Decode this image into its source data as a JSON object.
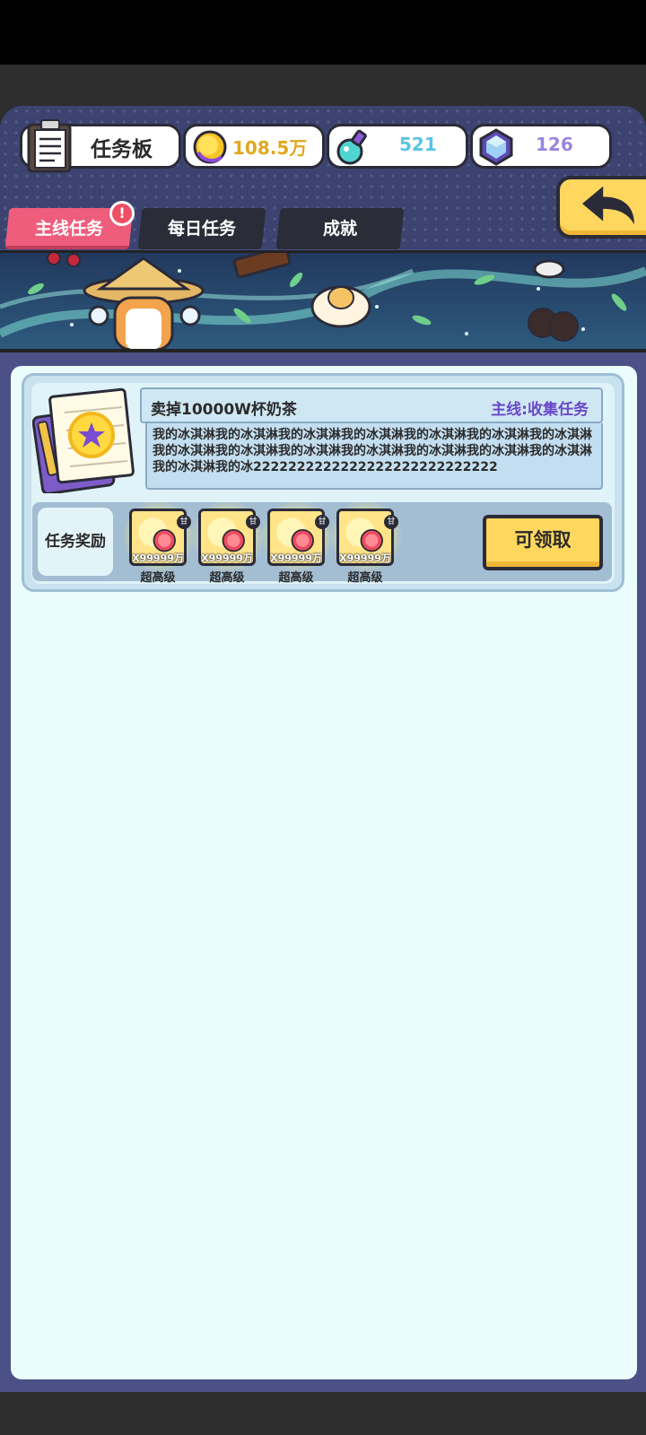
{
  "header": {
    "title": "任务板",
    "resources": {
      "gold": {
        "value": "108.5万",
        "color": "#e0a820"
      },
      "potion": {
        "value": "521",
        "color": "#5ac3e6"
      },
      "gem": {
        "value": "126",
        "color": "#9a84e0"
      }
    }
  },
  "tabs": [
    {
      "label": "主线任务",
      "active": true
    },
    {
      "label": "每日任务",
      "active": false
    },
    {
      "label": "成就",
      "active": false
    }
  ],
  "alert": "!",
  "task": {
    "name": "卖掉10000W杯奶茶",
    "type": "主线:收集任务",
    "description": "我的冰淇淋我的冰淇淋我的冰淇淋我的冰淇淋我的冰淇淋我的冰淇淋我的冰淇淋我的冰淇淋我的冰淇淋我的冰淇淋我的冰淇淋我的冰淇淋我的冰淇淋我的冰淇淋我的冰淇淋我的冰2222222222222222222222222222",
    "reward_label": "任务奖励",
    "rewards": [
      {
        "qty": "X99999万",
        "grade": "超高级",
        "badge": "甘"
      },
      {
        "qty": "X99999万",
        "grade": "超高级",
        "badge": "甘"
      },
      {
        "qty": "X99999万",
        "grade": "超高级",
        "badge": "甘"
      },
      {
        "qty": "X99999万",
        "grade": "超高级",
        "badge": "甘"
      }
    ],
    "claim_label": "可领取"
  },
  "icons": {
    "back": "back-arrow-icon",
    "clipboard": "clipboard-icon",
    "coin": "coin-icon",
    "potion": "potion-icon",
    "gem": "gem-icon",
    "book": "notebook-star-icon",
    "reward": "grapefruit-icon"
  }
}
